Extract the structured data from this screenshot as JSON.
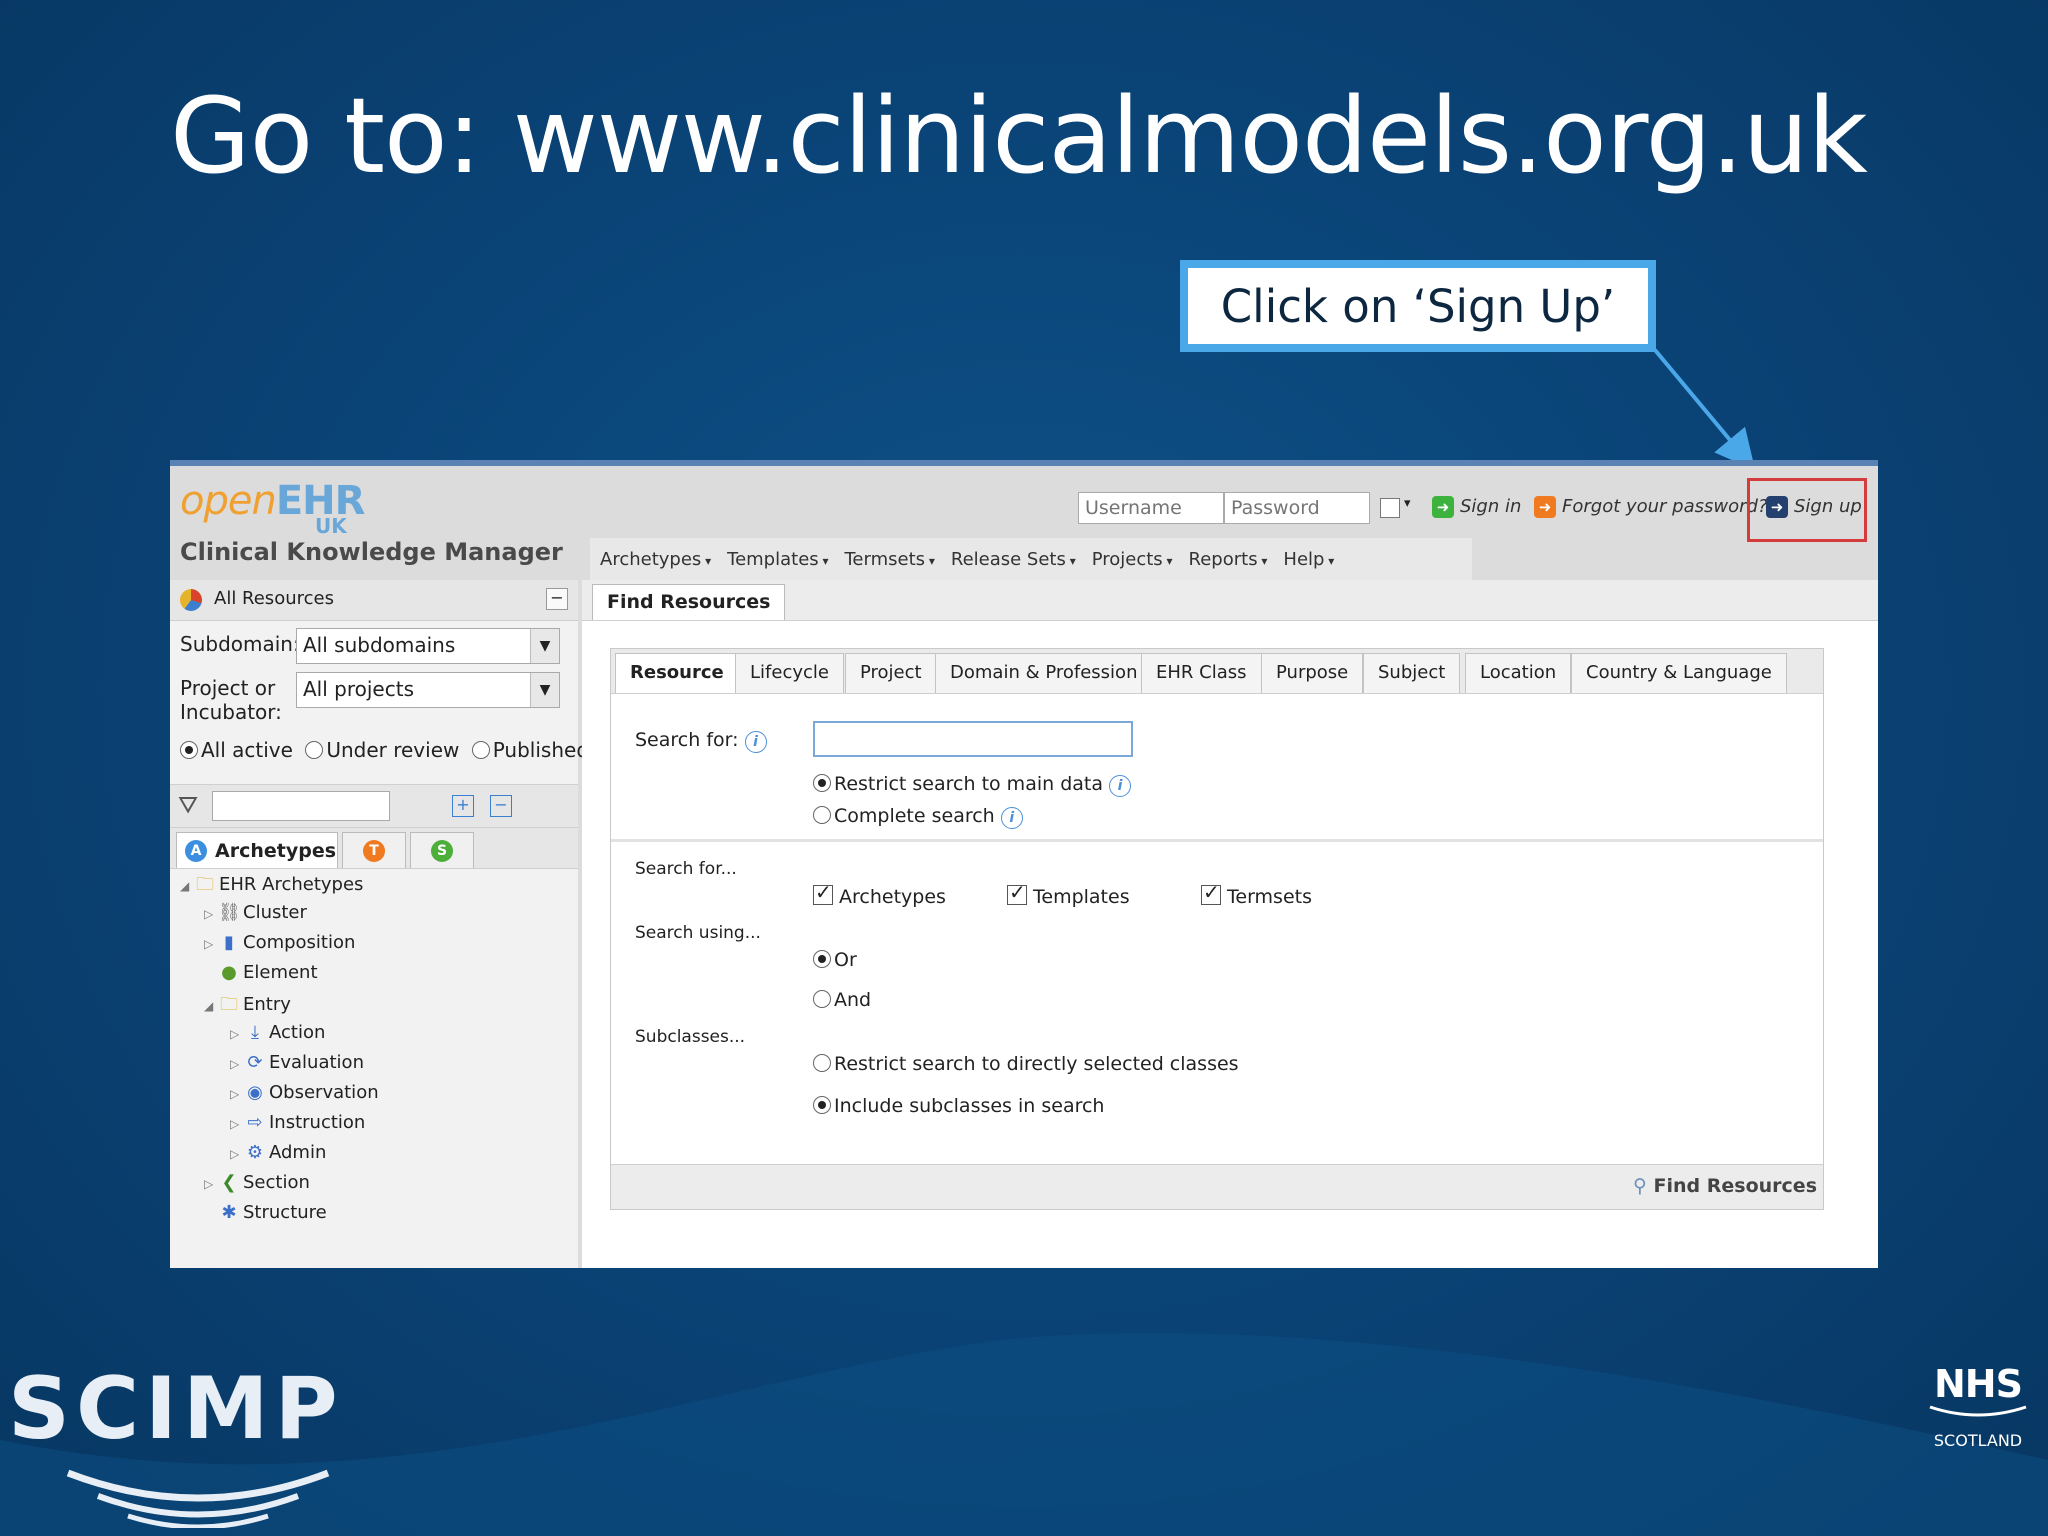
{
  "slide": {
    "title": "Go to: www.clinicalmodels.org.uk",
    "callout": "Click on ‘Sign Up’"
  },
  "app": {
    "logo_open": "open",
    "logo_ehr": "EHR",
    "logo_sub": "UK",
    "name": "Clinical Knowledge Manager"
  },
  "login": {
    "username_placeholder": "Username",
    "password_placeholder": "Password",
    "sign_in": "Sign in",
    "forgot": "Forgot your password?",
    "sign_up": "Sign up"
  },
  "menu": [
    "Archetypes",
    "Templates",
    "Termsets",
    "Release Sets",
    "Projects",
    "Reports",
    "Help"
  ],
  "left": {
    "header": "All Resources",
    "subdomain_label": "Subdomain:",
    "subdomain_value": "All subdomains",
    "project_label_1": "Project or",
    "project_label_2": "Incubator:",
    "project_value": "All projects",
    "status": {
      "all_active": "All active",
      "under_review": "Under review",
      "published": "Published"
    },
    "tabs": {
      "archetypes": "Archetypes",
      "templates_icon": "T",
      "termsets_icon": "S"
    },
    "tree": [
      {
        "label": "EHR Archetypes"
      },
      {
        "label": "Cluster"
      },
      {
        "label": "Composition"
      },
      {
        "label": "Element"
      },
      {
        "label": "Entry"
      },
      {
        "label": "Action"
      },
      {
        "label": "Evaluation"
      },
      {
        "label": "Observation"
      },
      {
        "label": "Instruction"
      },
      {
        "label": "Admin"
      },
      {
        "label": "Section"
      },
      {
        "label": "Structure"
      }
    ]
  },
  "main": {
    "tab": "Find Resources",
    "subtabs": [
      "Resource",
      "Lifecycle",
      "Project",
      "Domain & Profession",
      "EHR Class",
      "Purpose",
      "Subject",
      "Location",
      "Country & Language"
    ],
    "search_for_label": "Search for:",
    "restrict_main": "Restrict search to main data",
    "complete_search": "Complete search",
    "search_for_section": "Search for...",
    "types": [
      "Archetypes",
      "Templates",
      "Termsets"
    ],
    "search_using": "Search using...",
    "or": "Or",
    "and": "And",
    "subclasses": "Subclasses...",
    "restrict_classes": "Restrict search to directly selected classes",
    "include_subclasses": "Include subclasses in search",
    "find_button": "Find Resources"
  },
  "branding": {
    "scimp": "SCIMP",
    "nhs": "NHS",
    "nhs_sub": "SCOTLAND"
  },
  "colors": {
    "background": "#0a4275",
    "callout_border": "#4aa8e8",
    "highlight": "#d43b3b"
  }
}
